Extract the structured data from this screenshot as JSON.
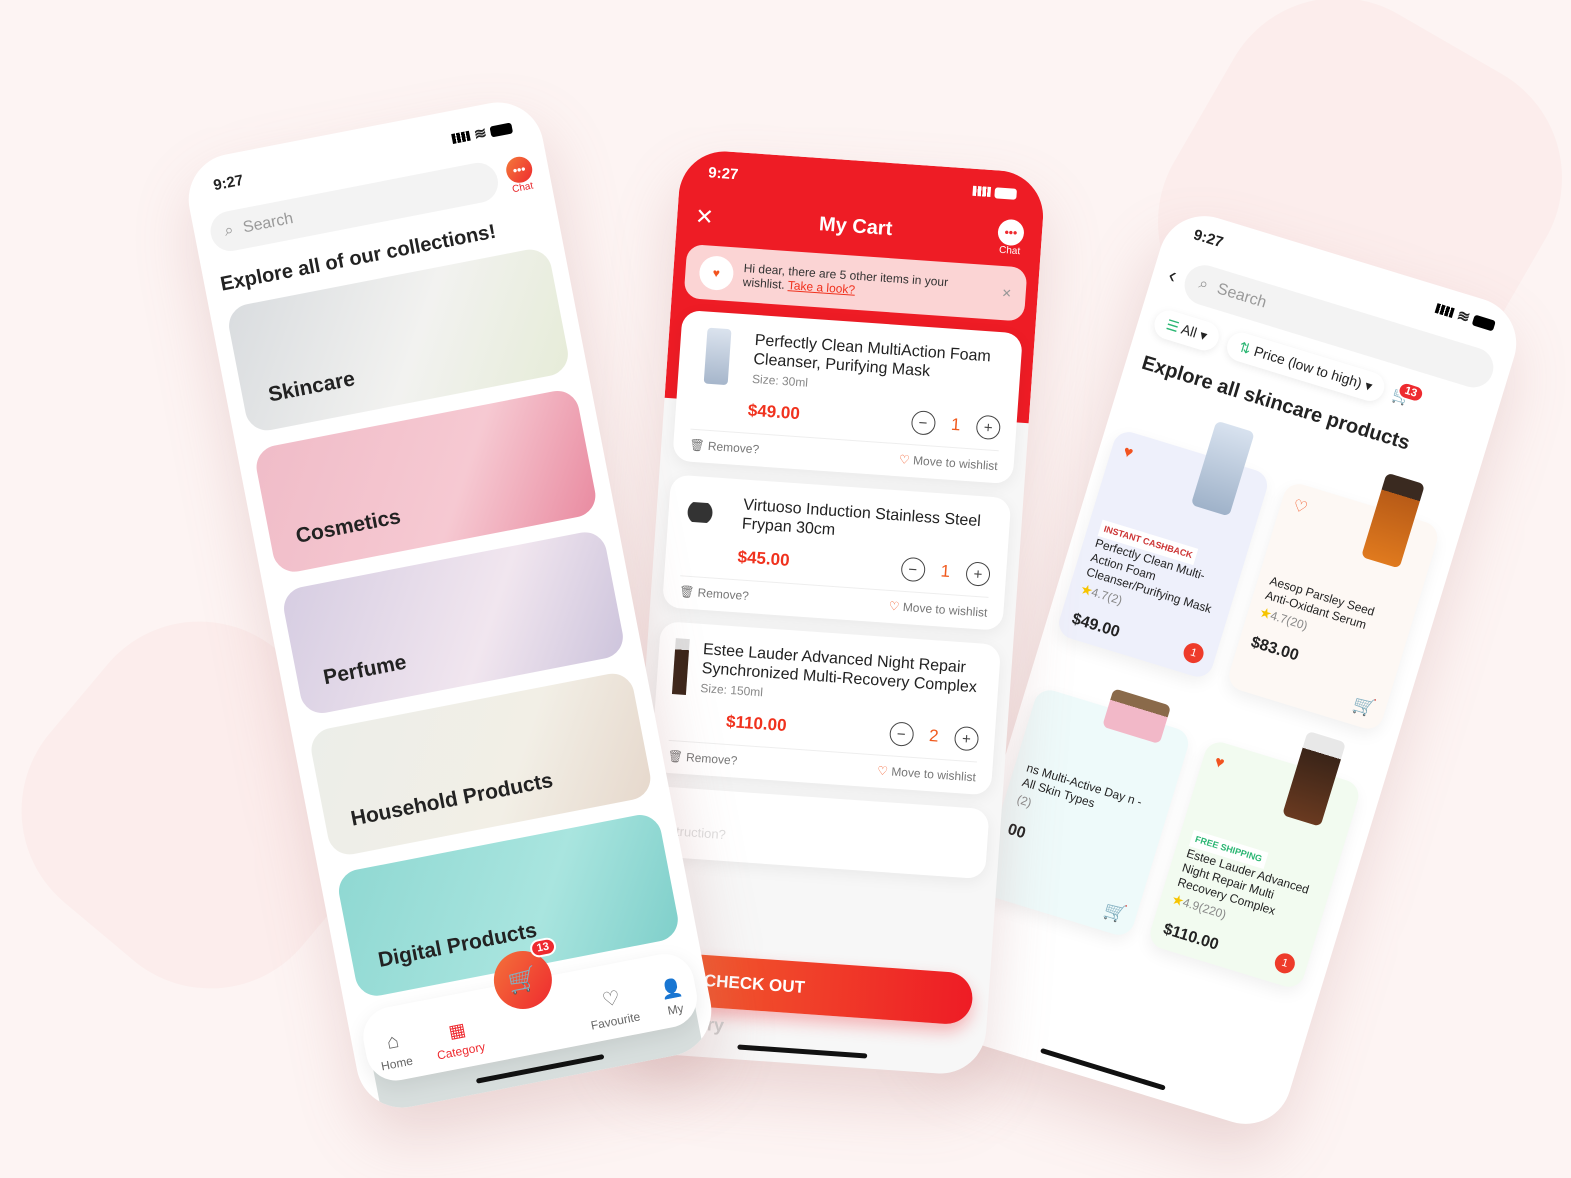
{
  "left_phone": {
    "time": "9:27",
    "search_placeholder": "Search",
    "chat_label": "Chat",
    "title": "Explore all of our collections!",
    "categories": [
      "Skincare",
      "Cosmetics",
      "Perfume",
      "Household Products",
      "Digital Products"
    ],
    "nav": {
      "home": "Home",
      "category": "Category",
      "cart_count": "13",
      "favourite": "Favourite",
      "my": "My"
    }
  },
  "cart_phone": {
    "time": "9:27",
    "title": "My Cart",
    "chat_label": "Chat",
    "banner": {
      "text": "Hi dear, there are 5 other items in your wishlist.",
      "link": "Take a look?"
    },
    "items": [
      {
        "name": "Perfectly Clean MultiAction Foam Cleanser, Purifying Mask",
        "size": "Size: 30ml",
        "price": "$49.00",
        "qty": "1"
      },
      {
        "name": "Virtuoso Induction Stainless Steel Frypan 30cm",
        "size": "",
        "price": "$45.00",
        "qty": "1"
      },
      {
        "name": "Estee Lauder Advanced Night Repair Synchronized Multi-Recovery Complex",
        "size": "Size: 150ml",
        "price": "$110.00",
        "qty": "2"
      }
    ],
    "remove_label": "Remove?",
    "wishlist_label": "Move to wishlist",
    "checkout": "CHECK OUT",
    "summary_partial": "mary",
    "instruction_partial": "nstruction?"
  },
  "list_phone": {
    "time": "9:27",
    "search_placeholder": "Search",
    "filter": "All",
    "sort": "Price (low to high)",
    "cart_count": "13",
    "title": "Explore all skincare products",
    "products": [
      {
        "tag": "INSTANT CASHBACK",
        "name": "Perfectly Clean Multi-Action Foam Cleanser/Purifying Mask",
        "rating": "4.7(2)",
        "price": "$49.00",
        "in_cart": "1",
        "bg": "#eef0fb",
        "favorited": true
      },
      {
        "tag": "",
        "name": "Aesop Parsley Seed Anti-Oxidant Serum",
        "rating": "4.7(20)",
        "price": "$83.00",
        "in_cart": "",
        "bg": "#fdf8f4",
        "favorited": false
      },
      {
        "tag": "",
        "name": "ns Multi-Active Day n - All Skin Types",
        "rating": "(2)",
        "price": "00",
        "in_cart": "",
        "bg": "#eefafa",
        "favorited": false
      },
      {
        "tag": "FREE SHIPPING",
        "name": "Estee Lauder Advanced Night Repair Multi Recovery Complex",
        "rating": "4.9(220)",
        "price": "$110.00",
        "in_cart": "1",
        "bg": "#f2fbf0",
        "favorited": true
      }
    ]
  },
  "colors": {
    "accent": "#ee2a2f",
    "orange": "#f4723a",
    "background": "#fdf4f3"
  }
}
